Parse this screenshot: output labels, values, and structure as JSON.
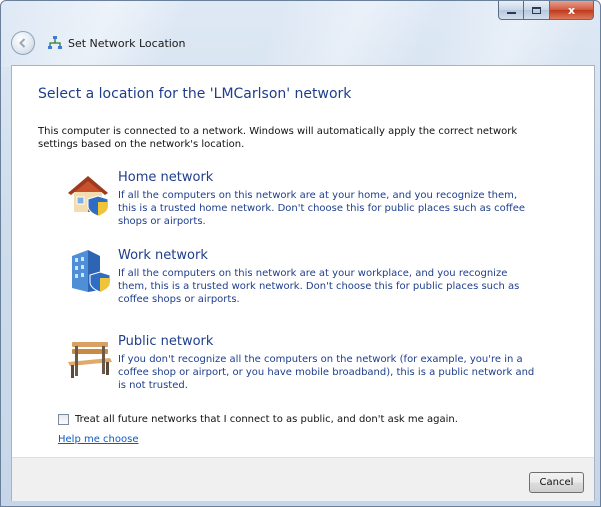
{
  "window": {
    "title": "Set Network Location",
    "caption_buttons": {
      "close_label": "x"
    }
  },
  "main": {
    "heading": "Select a location for the 'LMCarlson' network",
    "intro": "This computer is connected to a network. Windows will automatically apply the correct network settings based on the network's location.",
    "options": [
      {
        "title": "Home network",
        "description": "If all the computers on this network are at your home, and you recognize them, this is a trusted home network.  Don't choose this for public places such as coffee shops or airports.",
        "icon": "house-shield-icon"
      },
      {
        "title": "Work network",
        "description": "If all the computers on this network are at your workplace, and you recognize them, this is a trusted work network.  Don't choose this for public places such as coffee shops or airports.",
        "icon": "office-building-shield-icon"
      },
      {
        "title": "Public network",
        "description": "If you don't recognize all the computers on the network (for example, you're in a coffee shop or airport, or you have mobile broadband), this is a public network and is not trusted.",
        "icon": "park-bench-icon"
      }
    ],
    "checkbox_label": "Treat all future networks that I connect to as public, and don't ask me again.",
    "help_link": "Help me choose"
  },
  "footer": {
    "cancel_label": "Cancel"
  },
  "colors": {
    "heading": "#1e3e8c",
    "link": "#0a5bc4",
    "close_button": "#c0391c"
  }
}
